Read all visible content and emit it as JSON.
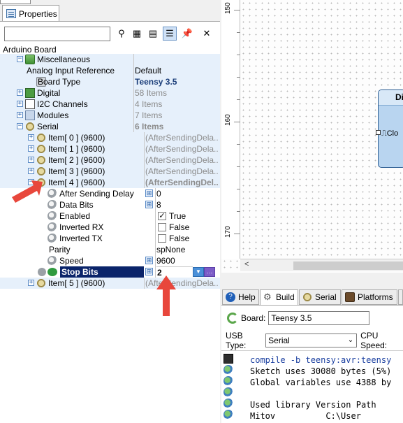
{
  "properties_panel": {
    "tab_label": "Properties",
    "search_value": "",
    "object_name": "Arduino Board",
    "tree": [
      {
        "name": "Miscellaneous",
        "value": "",
        "level": 1,
        "expander": "−",
        "icon": "folder-icon",
        "blue": true
      },
      {
        "name": "Analog Input Reference",
        "value": "Default",
        "level": 2,
        "blue": true
      },
      {
        "name": "Board Type",
        "value": "Teensy 3.5",
        "level": 2,
        "icon": "board-icon",
        "value_style": "bold-blue",
        "blue": true
      },
      {
        "name": "Digital",
        "value": "58 Items",
        "level": 1,
        "expander": "+",
        "icon": "digital-icon",
        "value_style": "gray",
        "blue": true
      },
      {
        "name": "I2C Channels",
        "value": "4 Items",
        "level": 1,
        "expander": "+",
        "icon": "i2c-icon",
        "value_style": "gray",
        "blue": true
      },
      {
        "name": "Modules",
        "value": "7 Items",
        "level": 1,
        "expander": "+",
        "icon": "module-icon",
        "value_style": "gray",
        "blue": true
      },
      {
        "name": "Serial",
        "value": "6 Items",
        "level": 1,
        "expander": "−",
        "icon": "serial-icon",
        "value_style": "gray-bold",
        "blue": true
      },
      {
        "name": "Item[ 0 ] (9600)",
        "value": "(AfterSendingDela...",
        "level": 2,
        "expander": "+",
        "icon": "serial-icon",
        "value_style": "gray",
        "blue": true
      },
      {
        "name": "Item[ 1 ] (9600)",
        "value": "(AfterSendingDela...",
        "level": 2,
        "expander": "+",
        "icon": "serial-icon",
        "value_style": "gray",
        "blue": true
      },
      {
        "name": "Item[ 2 ] (9600)",
        "value": "(AfterSendingDela...",
        "level": 2,
        "expander": "+",
        "icon": "serial-icon",
        "value_style": "gray",
        "blue": true
      },
      {
        "name": "Item[ 3 ] (9600)",
        "value": "(AfterSendingDela...",
        "level": 2,
        "expander": "+",
        "icon": "serial-icon",
        "value_style": "gray",
        "blue": true
      },
      {
        "name": "Item[ 4 ] (9600)",
        "value": "(AfterSendingDel...",
        "level": 2,
        "expander": "−",
        "icon": "serial-icon",
        "value_style": "gray-bold",
        "blue": true
      },
      {
        "name": "After Sending Delay (u...",
        "value": "0",
        "level": 3,
        "icon": "wrench-icon",
        "inline_btn": true
      },
      {
        "name": "Data Bits",
        "value": "8",
        "level": 3,
        "icon": "wrench-icon",
        "inline_btn": true
      },
      {
        "name": "Enabled",
        "value": "True",
        "level": 3,
        "icon": "wrench-icon",
        "checkbox": true,
        "checked": true
      },
      {
        "name": "Inverted RX",
        "value": "False",
        "level": 3,
        "icon": "wrench-icon",
        "checkbox": true,
        "checked": false
      },
      {
        "name": "Inverted TX",
        "value": "False",
        "level": 3,
        "icon": "wrench-icon",
        "checkbox": true,
        "checked": false
      },
      {
        "name": "Parity",
        "value": "spNone",
        "level": 3
      },
      {
        "name": "Speed",
        "value": "9600",
        "level": 3,
        "icon": "wrench-icon",
        "inline_btn": true
      },
      {
        "name": "Stop Bits",
        "value": "2",
        "level": 3,
        "selected": true,
        "inline_btn": true,
        "editing": true
      },
      {
        "name": "Item[ 5 ] (9600)",
        "value": "(AfterSendingDela...",
        "level": 2,
        "expander": "+",
        "icon": "serial-icon",
        "value_style": "gray",
        "blue": true
      }
    ],
    "check_mark": "✓"
  },
  "canvas": {
    "ruler_labels": [
      "150",
      "160",
      "170"
    ],
    "component_title": "Di",
    "component_pin": "Clo"
  },
  "bottom_panel": {
    "tabs": [
      {
        "label": "Help",
        "icon": "help-icon",
        "active": false
      },
      {
        "label": "Build",
        "icon": "build-icon",
        "active": true
      },
      {
        "label": "Serial",
        "icon": "serial-icon",
        "active": false
      },
      {
        "label": "Platforms",
        "icon": "platforms-icon",
        "active": false
      }
    ],
    "board_label": "Board:",
    "board_value": "Teensy 3.5",
    "usb_type_label": "USB Type:",
    "usb_type_value": "Serial",
    "cpu_speed_label": "CPU Speed:",
    "output_lines": [
      "compile -b teensy:avr:teensy",
      "Sketch uses 30080 bytes (5%)",
      "Global variables use 4388 by",
      "",
      "Used library Version Path",
      "Mitov          C:\\User"
    ]
  },
  "colors": {
    "accent_arrow": "#e8473c",
    "selection": "#0a246a",
    "row_tint": "#e6f0fb"
  }
}
